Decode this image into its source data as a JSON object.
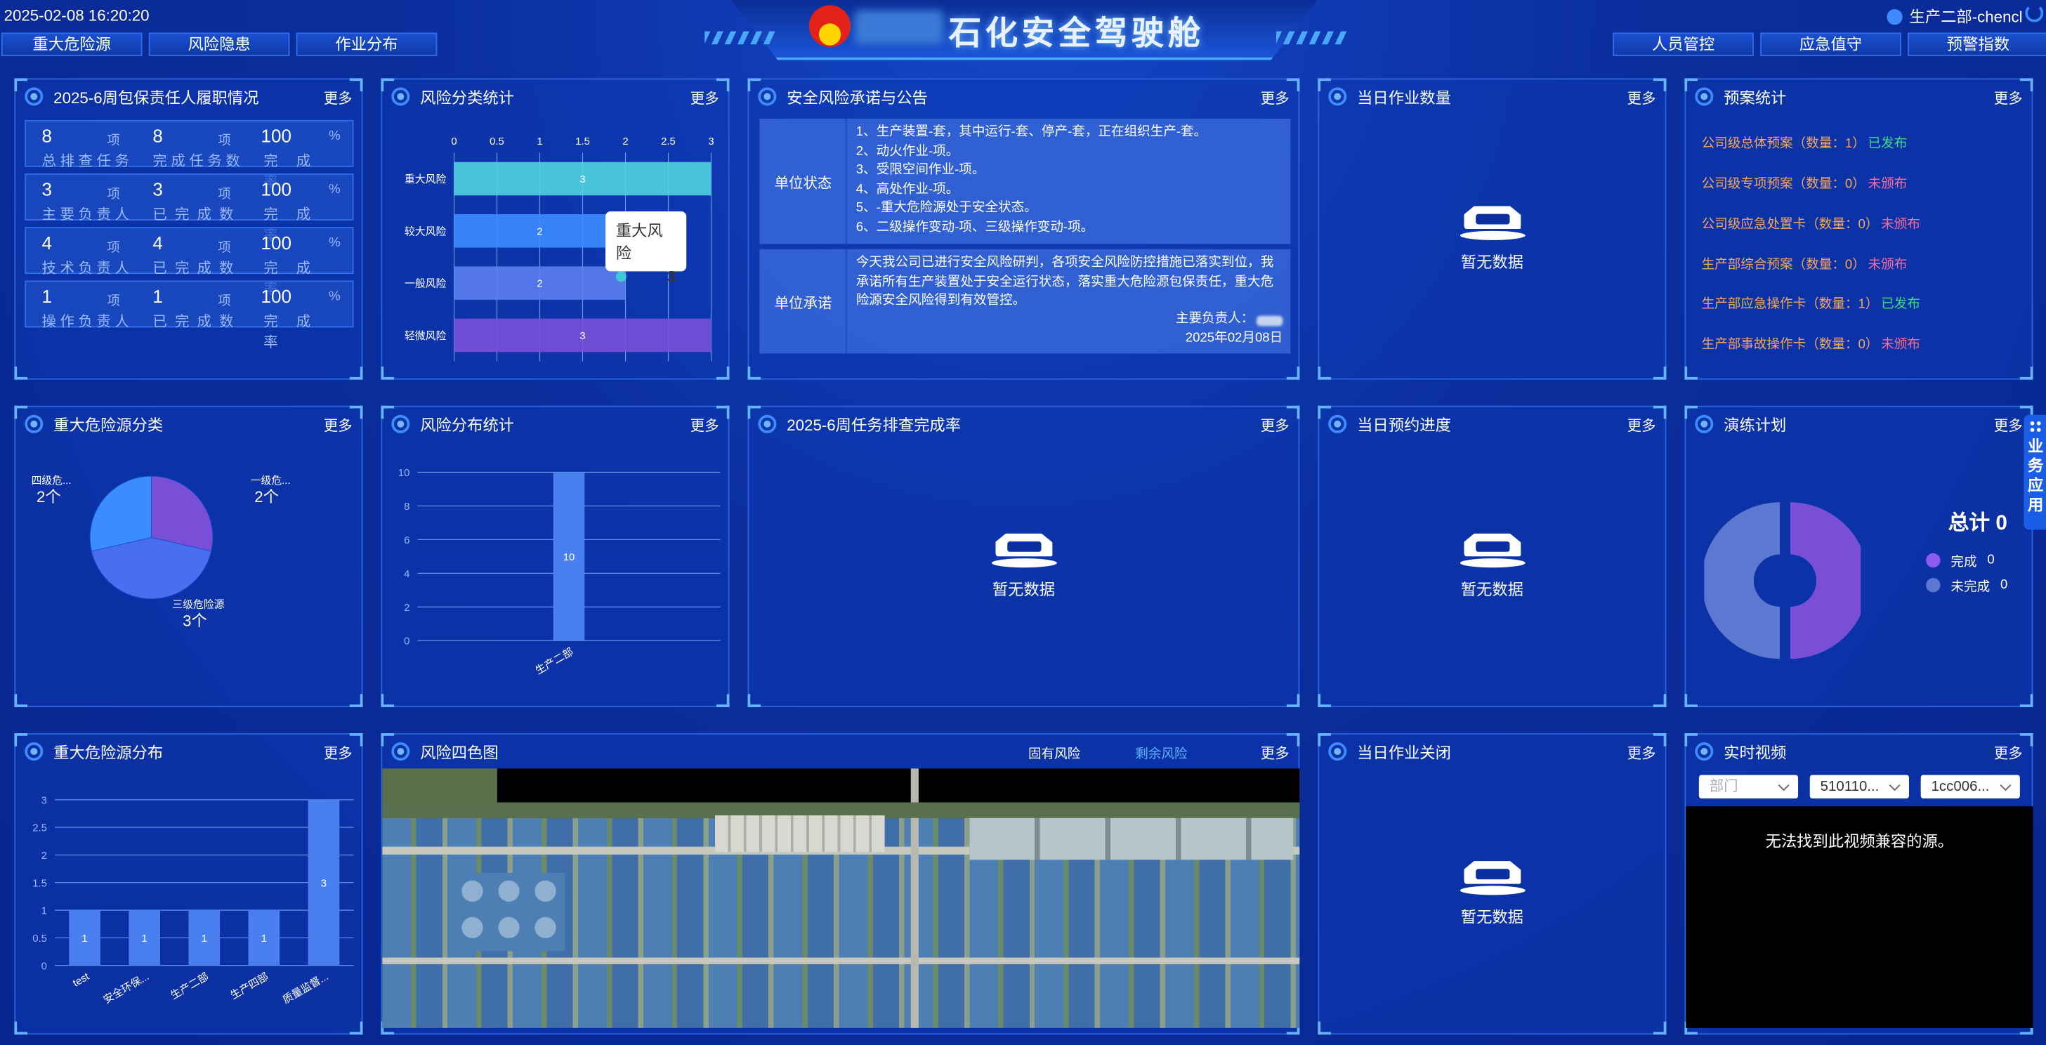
{
  "header": {
    "datetime": "2025-02-08 16:20:20",
    "title": "石化安全驾驶舱",
    "user": "生产二部-chencl",
    "nav_left": [
      "重大危险源",
      "风险隐患",
      "作业分布"
    ],
    "nav_right": [
      "人员管控",
      "应急值守",
      "预警指数"
    ]
  },
  "common": {
    "more": "更多",
    "no_data": "暂无数据"
  },
  "duty": {
    "title": "2025-6周包保责任人履职情况",
    "unit_item": "项",
    "unit_pct": "%",
    "rows": [
      {
        "a": "8",
        "a_label": "总排查任务",
        "b": "8",
        "b_label": "完成任务数",
        "c": "100",
        "c_label": "完成率"
      },
      {
        "a": "3",
        "a_label": "主要负责人",
        "b": "3",
        "b_label": "已完成数",
        "c": "100",
        "c_label": "完成率"
      },
      {
        "a": "4",
        "a_label": "技术负责人",
        "b": "4",
        "b_label": "已完成数",
        "c": "100",
        "c_label": "完成率"
      },
      {
        "a": "1",
        "a_label": "操作负责人",
        "b": "1",
        "b_label": "已完成数",
        "c": "100",
        "c_label": "完成率"
      }
    ]
  },
  "risk_class": {
    "title": "风险分类统计",
    "tooltip": {
      "name": "重大风险",
      "value": "3"
    }
  },
  "notice": {
    "title": "安全风险承诺与公告",
    "status_label": "单位状态",
    "status_lines": [
      "1、生产装置-套，其中运行-套、停产-套，正在组织生产-套。",
      "2、动火作业-项。",
      "3、受限空间作业-项。",
      "4、高处作业-项。",
      "5、-重大危险源处于安全状态。",
      "6、二级操作变动-项、三级操作变动-项。"
    ],
    "promise_label": "单位承诺",
    "promise_text": "今天我公司已进行安全风险研判，各项安全风险防控措施已落实到位，我承诺所有生产装置处于安全运行状态，落实重大危险源包保责任，重大危险源安全风险得到有效管控。",
    "principal_label": "主要负责人：",
    "date": "2025年02月08日"
  },
  "daily_work": {
    "title": "当日作业数量"
  },
  "plans": {
    "title": "预案统计",
    "items": [
      {
        "text": "公司级总体预案（数量：1）",
        "status": "已发布",
        "color": "#3ddc84"
      },
      {
        "text": "公司级专项预案（数量：0）",
        "status": "未颁布",
        "color": "#ff6b9a"
      },
      {
        "text": "公司级应急处置卡（数量：0）",
        "status": "未颁布",
        "color": "#ff6b9a"
      },
      {
        "text": "生产部综合预案（数量：0）",
        "status": "未颁布",
        "color": "#ff6b9a"
      },
      {
        "text": "生产部应急操作卡（数量：1）",
        "status": "已发布",
        "color": "#3ddc84"
      },
      {
        "text": "生产部事故操作卡（数量：0）",
        "status": "未颁布",
        "color": "#ff6b9a"
      }
    ]
  },
  "hazard_class": {
    "title": "重大危险源分类"
  },
  "risk_dist": {
    "title": "风险分布统计"
  },
  "task_rate": {
    "title": "2025-6周任务排查完成率"
  },
  "booking": {
    "title": "当日预约进度"
  },
  "drill": {
    "title": "演练计划",
    "total": "总计 0",
    "legend": [
      {
        "label": "完成",
        "value": "0"
      },
      {
        "label": "未完成",
        "value": "0"
      }
    ]
  },
  "hazard_dist": {
    "title": "重大危险源分布"
  },
  "risk_map": {
    "title": "风险四色图",
    "tab_fixed": "固有风险",
    "tab_residual": "剩余风险"
  },
  "work_close": {
    "title": "当日作业关闭"
  },
  "video": {
    "title": "实时视频",
    "selects": [
      "部门",
      "510110...",
      "1cc006..."
    ],
    "message": "无法找到此视频兼容的源。"
  },
  "side_tab": "业务应用",
  "chart_data": [
    {
      "type": "bar",
      "orientation": "horizontal",
      "title": "风险分类统计",
      "categories": [
        "重大风险",
        "较大风险",
        "一般风险",
        "轻微风险"
      ],
      "values": [
        3,
        2,
        2,
        3
      ],
      "xlim": [
        0,
        3
      ],
      "ticks": [
        "0",
        "0.5",
        "1",
        "1.5",
        "2",
        "2.5",
        "3"
      ]
    },
    {
      "type": "pie",
      "title": "重大危险源分类",
      "slices": [
        {
          "label": "一级危...",
          "value": 2,
          "value_label": "2个"
        },
        {
          "label": "三级危险源",
          "value": 3,
          "value_label": "3个"
        },
        {
          "label": "四级危...",
          "value": 2,
          "value_label": "2个"
        }
      ]
    },
    {
      "type": "bar",
      "title": "风险分布统计",
      "categories": [
        "生产二部"
      ],
      "values": [
        10
      ],
      "ylim": [
        0,
        10
      ],
      "ticks": [
        "0",
        "2",
        "4",
        "6",
        "8",
        "10"
      ]
    },
    {
      "type": "pie",
      "title": "演练计划",
      "slices": [
        {
          "label": "完成",
          "value": 0
        },
        {
          "label": "未完成",
          "value": 0
        }
      ]
    },
    {
      "type": "bar",
      "title": "重大危险源分布",
      "categories": [
        "test",
        "安全环保...",
        "生产二部",
        "生产四部",
        "质量监督..."
      ],
      "values": [
        1,
        1,
        1,
        1,
        3
      ],
      "ylim": [
        0,
        3
      ],
      "ticks": [
        "0",
        "0.5",
        "1",
        "1.5",
        "2",
        "2.5",
        "3"
      ]
    }
  ]
}
